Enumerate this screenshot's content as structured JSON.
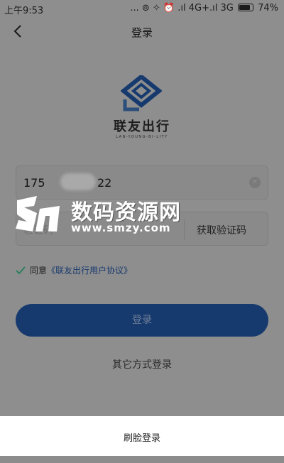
{
  "status_bar": {
    "time": "上午9:53",
    "indicators": "... ⊚ ✧ ⏰ .ıl 4G+.ıl 3G",
    "battery": "74%"
  },
  "nav": {
    "title": "登录",
    "back_icon": "chevron-left-icon"
  },
  "brand": {
    "name": "联友出行",
    "subtitle": "LAN-YOUNG-BI-LITY"
  },
  "phone_field": {
    "value_prefix": "175",
    "value_suffix": "22"
  },
  "code_field": {
    "placeholder": "验证码",
    "get_code_label": "获取验证码"
  },
  "agreement": {
    "prefix": "同意",
    "link": "《联友出行用户协议》"
  },
  "login_button": {
    "label": "登录"
  },
  "other_login": {
    "label": "其它方式登录"
  },
  "watermark": {
    "cn": "数码资源网",
    "en": "www.smzy.com"
  },
  "sheet": {
    "face_login": "刷脸登录"
  },
  "colors": {
    "primary": "#1e4c95",
    "overlay": "#8e8e8e"
  }
}
